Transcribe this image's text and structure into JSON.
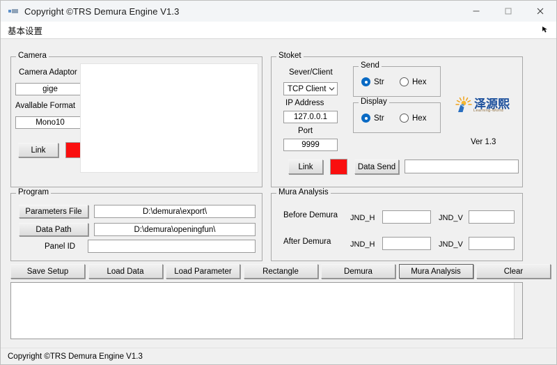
{
  "window": {
    "title": "Copyright ©TRS Demura Engine V1.3",
    "app_icon": "app-icon",
    "minimize_label": "minimize-icon",
    "maximize_label": "maximize-icon",
    "close_label": "close-icon"
  },
  "menubar": {
    "items": [
      {
        "label": "基本设置"
      }
    ],
    "right_icon": "cursor-arrow-icon"
  },
  "camera": {
    "legend": "Camera",
    "adaptor_label": "Camera Adaptor",
    "adaptor_value": "gige",
    "format_label": "Avallable Format",
    "format_value": "Mono10",
    "link_button": "Link",
    "lamp_color": "#fa0f0f"
  },
  "stoket": {
    "legend": "Stoket",
    "mode_label": "Sever/Client",
    "mode_value": "TCP Client",
    "mode_options": [
      "TCP Client"
    ],
    "ip_label": "IP Address",
    "ip_value": "127.0.0.1",
    "port_label": "Port",
    "port_value": "9999",
    "link_button": "Link",
    "lamp_color": "#fa0f0f",
    "data_send_button": "Data Send",
    "data_send_value": "",
    "data_send_placeholder": "",
    "send": {
      "legend": "Send",
      "options": [
        {
          "label": "Str",
          "selected": true
        },
        {
          "label": "Hex",
          "selected": false
        }
      ]
    },
    "display": {
      "legend": "Display",
      "options": [
        {
          "label": "Str",
          "selected": true
        },
        {
          "label": "Hex",
          "selected": false
        }
      ]
    }
  },
  "brand": {
    "name_cn": "泽源熙",
    "tagline": "Learning-World",
    "version": "Ver 1.3",
    "accent": "#1b4f9c"
  },
  "program": {
    "legend": "Program",
    "parameters_file_button": "Parameters File",
    "parameters_file_value": "D:\\demura\\export\\",
    "data_path_button": "Data Path",
    "data_path_value": "D:\\demura\\openingfun\\",
    "panel_id_label": "Panel ID",
    "panel_id_value": "",
    "panel_id_placeholder": ""
  },
  "mura": {
    "legend": "Mura Analysis",
    "rows": [
      {
        "label": "Before Demura",
        "h_label": "JND_H",
        "h_value": "",
        "v_label": "JND_V",
        "v_value": ""
      },
      {
        "label": "After Demura",
        "h_label": "JND_H",
        "h_value": "",
        "v_label": "JND_V",
        "v_value": ""
      }
    ]
  },
  "actions": [
    {
      "label": "Save Setup"
    },
    {
      "label": "Load Data"
    },
    {
      "label": "Load Parameter"
    },
    {
      "label": "Rectangle"
    },
    {
      "label": "Demura"
    },
    {
      "label": "Mura Analysis"
    },
    {
      "label": "Clear"
    }
  ],
  "log": {
    "value": ""
  },
  "statusbar": {
    "text": "Copyright ©TRS Demura Engine V1.3"
  }
}
